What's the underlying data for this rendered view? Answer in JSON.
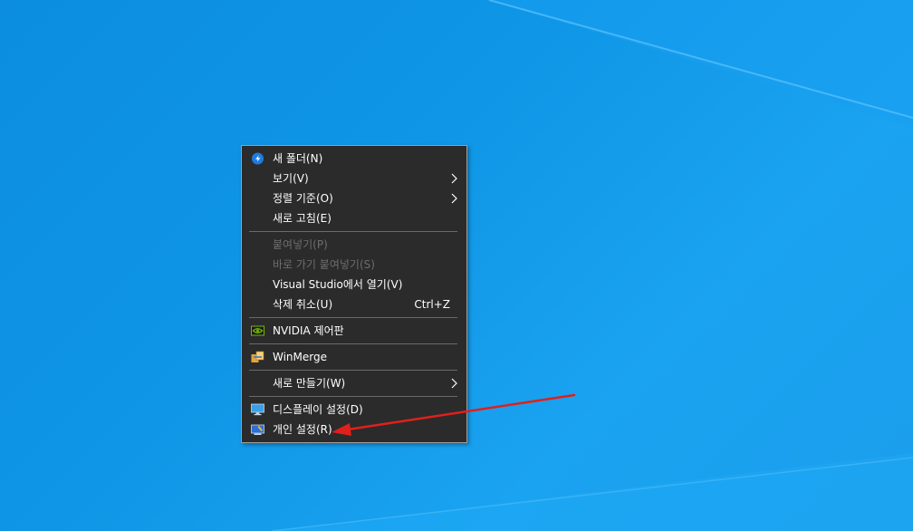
{
  "context_menu": {
    "items": [
      {
        "label": "새 폴더(N)"
      },
      {
        "label": "보기(V)"
      },
      {
        "label": "정렬 기준(O)"
      },
      {
        "label": "새로 고침(E)"
      },
      {
        "label": "붙여넣기(P)"
      },
      {
        "label": "바로 가기 붙여넣기(S)"
      },
      {
        "label": "Visual Studio에서 열기(V)"
      },
      {
        "label": "삭제 취소(U)",
        "shortcut": "Ctrl+Z"
      },
      {
        "label": "NVIDIA 제어판"
      },
      {
        "label": "WinMerge"
      },
      {
        "label": "새로 만들기(W)"
      },
      {
        "label": "디스플레이 설정(D)"
      },
      {
        "label": "개인 설정(R)"
      }
    ]
  },
  "colors": {
    "menu_background": "#2b2b2b",
    "menu_text": "#ffffff",
    "disabled_text": "#6d6d6d",
    "annotation_arrow": "#e0201b",
    "desktop": "#0f96e6"
  },
  "icons": {
    "new_folder": "shield-icon",
    "view_submenu": "chevron-right-icon",
    "sort_submenu": "chevron-right-icon",
    "nvidia": "nvidia-icon",
    "winmerge": "winmerge-icon",
    "new_submenu": "chevron-right-icon",
    "display": "monitor-icon",
    "personalize": "personalize-icon"
  }
}
